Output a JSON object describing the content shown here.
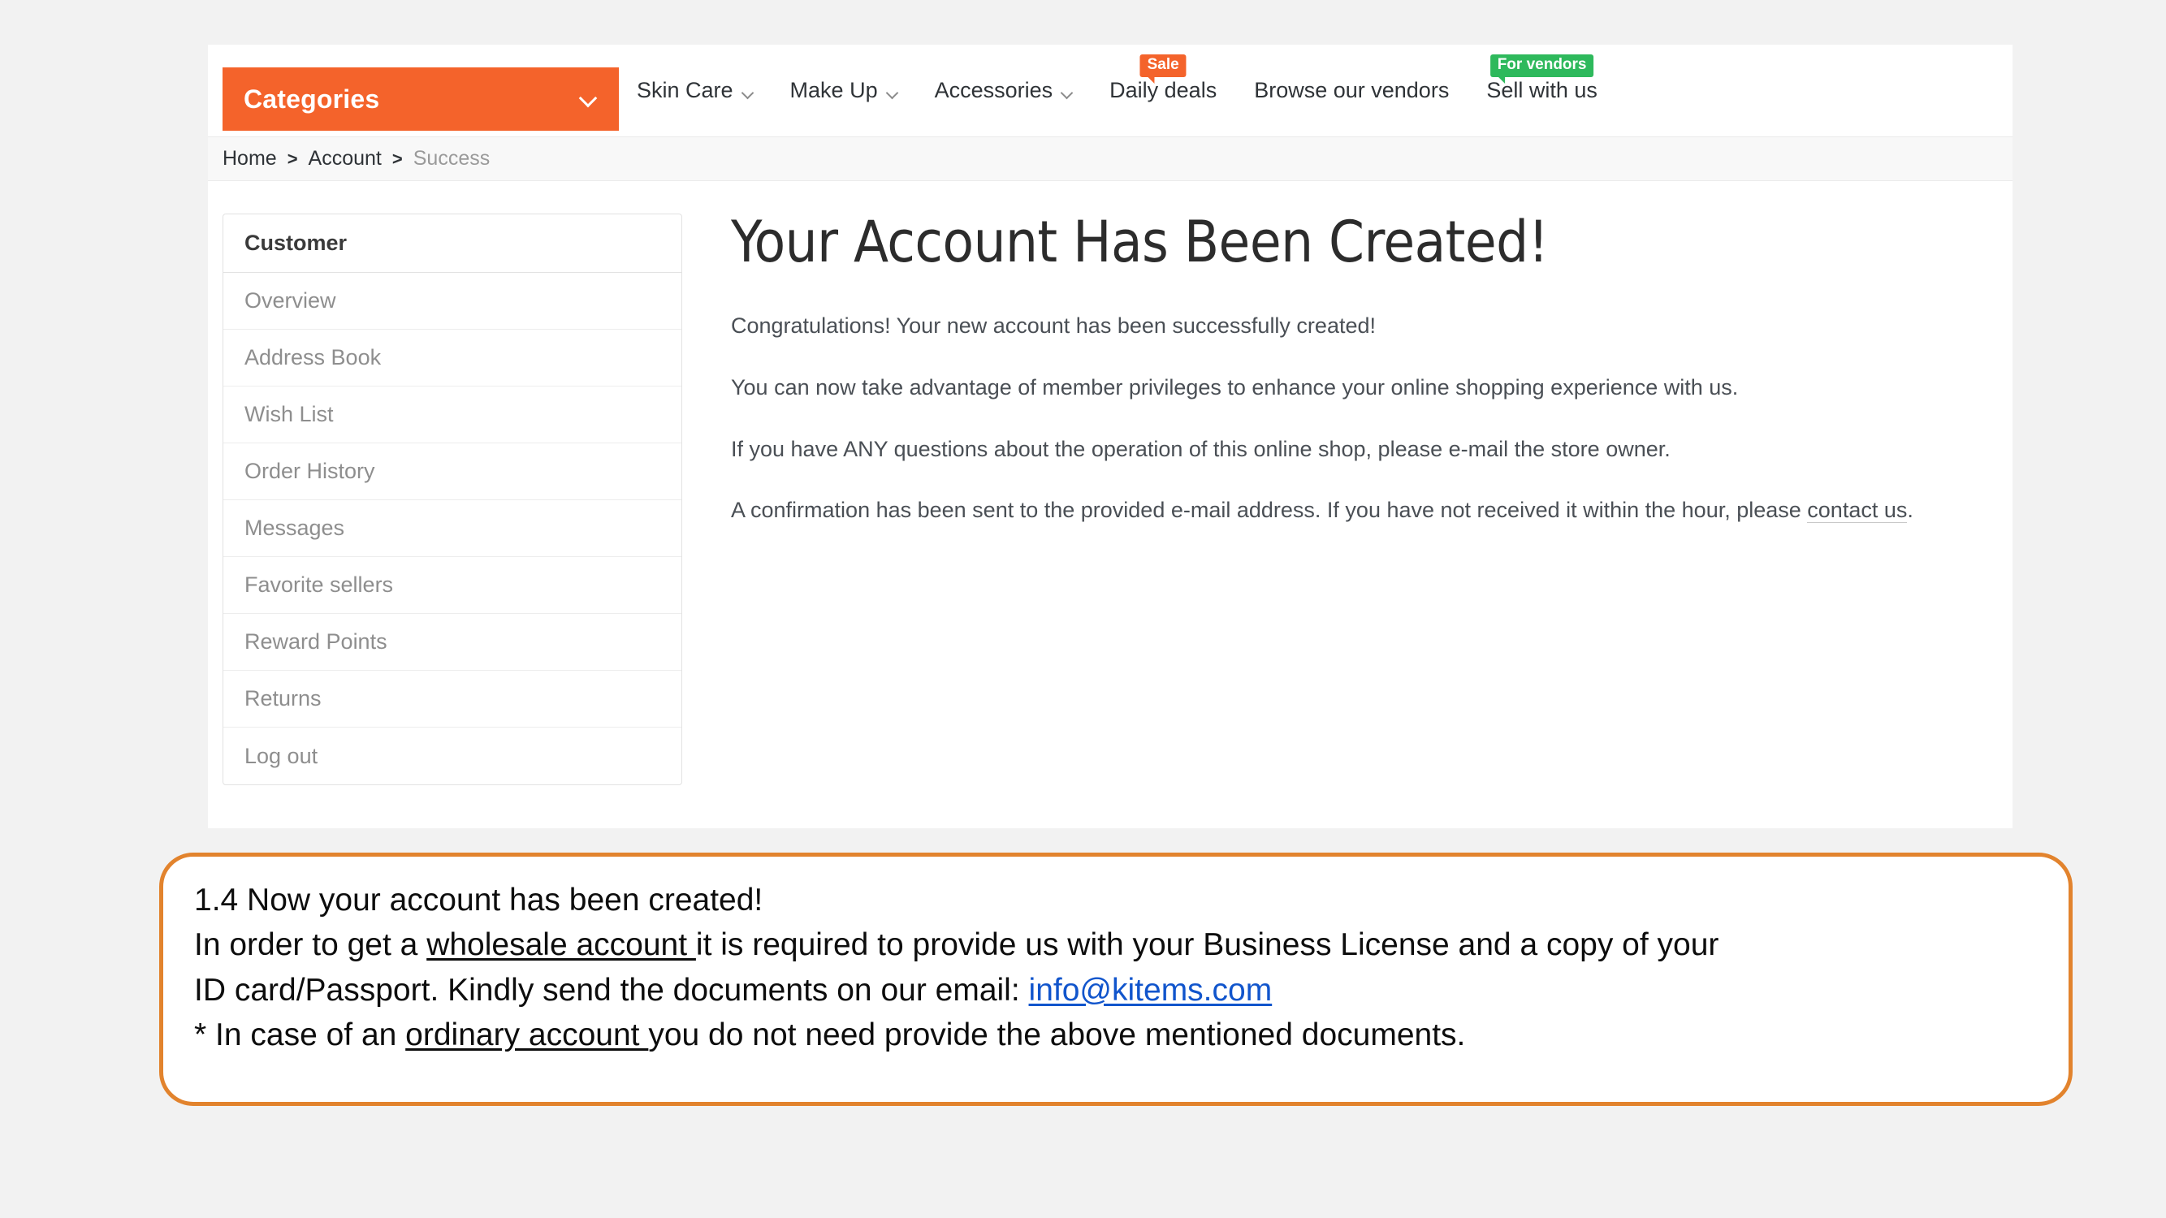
{
  "nav": {
    "categories_label": "Categories",
    "categories_chevron": "chevron-down-icon",
    "items": [
      {
        "label": "Skin Care",
        "has_chevron": true,
        "badge": null
      },
      {
        "label": "Make Up",
        "has_chevron": true,
        "badge": null
      },
      {
        "label": "Accessories",
        "has_chevron": true,
        "badge": null
      },
      {
        "label": "Daily deals",
        "has_chevron": false,
        "badge": "Sale",
        "badge_color": "#f4632b"
      },
      {
        "label": "Browse our vendors",
        "has_chevron": false,
        "badge": null
      },
      {
        "label": "Sell with us",
        "has_chevron": false,
        "badge": "For vendors",
        "badge_color": "#2eb95c"
      }
    ]
  },
  "breadcrumb": {
    "separator": ">",
    "items": [
      {
        "label": "Home",
        "current": false
      },
      {
        "label": "Account",
        "current": false
      },
      {
        "label": "Success",
        "current": true
      }
    ]
  },
  "sidebar": {
    "header": "Customer",
    "items": [
      {
        "label": "Overview"
      },
      {
        "label": "Address Book"
      },
      {
        "label": "Wish List"
      },
      {
        "label": "Order History"
      },
      {
        "label": "Messages"
      },
      {
        "label": "Favorite sellers"
      },
      {
        "label": "Reward Points"
      },
      {
        "label": "Returns"
      },
      {
        "label": "Log out"
      }
    ]
  },
  "main": {
    "title": "Your Account Has Been Created!",
    "paragraph1": "Congratulations! Your new account has been successfully created!",
    "paragraph2": "You can now take advantage of member privileges to enhance your online shopping experience with us.",
    "paragraph3": "If you have ANY questions about the operation of this online shop, please e-mail the store owner.",
    "paragraph4_before": "A confirmation has been sent to the provided e-mail address. If you have not received it within the hour, please ",
    "paragraph4_link": "contact us",
    "paragraph4_after": "."
  },
  "callout": {
    "border_color": "#e2832d",
    "line1": "1.4 Now your account has been created!",
    "line2_a": "In order to get a ",
    "line2_underlined": "wholesale account ",
    "line2_b": "it is required to provide us with your Business License and a copy of your",
    "line3_a": "ID card/Passport. Kindly send the documents on our email: ",
    "line3_email": "info@kitems.com",
    "line4_a": "* In case of an ",
    "line4_underlined": "ordinary account ",
    "line4_b": "you do not need provide the above mentioned documents."
  }
}
